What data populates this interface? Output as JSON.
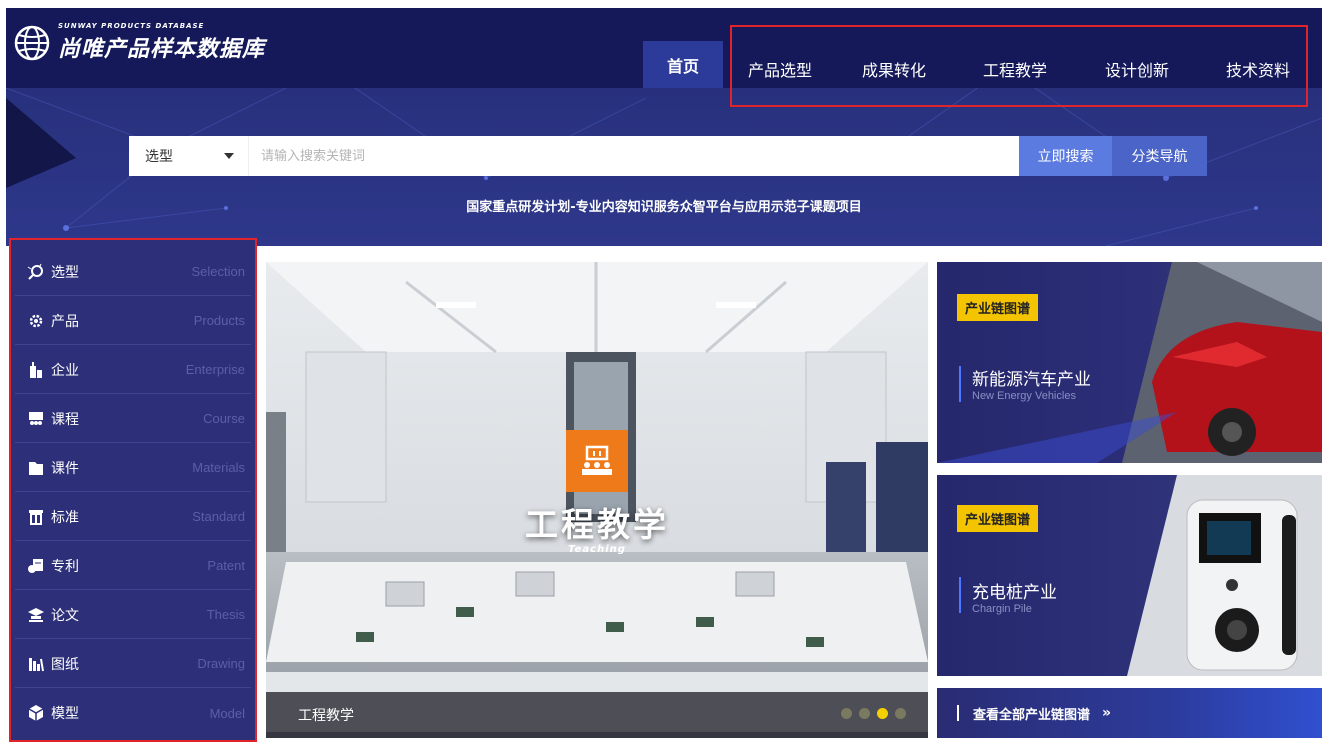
{
  "header": {
    "logo_sub": "SUNWAY PRODUCTS DATABASE",
    "logo_main": "尚唯产品样本数据库",
    "home": "首页",
    "nav": [
      "产品选型",
      "成果转化",
      "工程教学",
      "设计创新",
      "技术资料"
    ]
  },
  "search": {
    "select_value": "选型",
    "placeholder": "请输入搜索关键词",
    "search_button": "立即搜索",
    "category_button": "分类导航"
  },
  "slogan": "国家重点研发计划-专业内容知识服务众智平台与应用示范子课题项目",
  "sidebar": {
    "items": [
      {
        "label": "选型",
        "en": "Selection",
        "icon": "selection-icon"
      },
      {
        "label": "产品",
        "en": "Products",
        "icon": "gear-icon"
      },
      {
        "label": "企业",
        "en": "Enterprise",
        "icon": "building-icon"
      },
      {
        "label": "课程",
        "en": "Course",
        "icon": "course-icon"
      },
      {
        "label": "课件",
        "en": "Materials",
        "icon": "folder-icon"
      },
      {
        "label": "标准",
        "en": "Standard",
        "icon": "standard-icon"
      },
      {
        "label": "专利",
        "en": "Patent",
        "icon": "patent-icon"
      },
      {
        "label": "论文",
        "en": "Thesis",
        "icon": "graduation-icon"
      },
      {
        "label": "图纸",
        "en": "Drawing",
        "icon": "drawing-icon"
      },
      {
        "label": "模型",
        "en": "Model",
        "icon": "cube-icon"
      }
    ]
  },
  "banner": {
    "title": "工程教学",
    "subtitle": "Teaching",
    "caption": "工程教学",
    "active_dot": 3,
    "dot_count": 4
  },
  "cards": [
    {
      "tag": "产业链图谱",
      "title": "新能源汽车产业",
      "en": "New Energy Vehicles"
    },
    {
      "tag": "产业链图谱",
      "title": "充电桩产业",
      "en": "Chargin Pile"
    }
  ],
  "all_link": "查看全部产业链图谱",
  "colors": {
    "nav_bg": "#15195a",
    "sidebar_bg": "#2d3079",
    "highlight_border": "#e0242b",
    "search_button": "#5b7be0",
    "tag": "#f5c400",
    "teaching_badge": "#ef7a1a"
  }
}
